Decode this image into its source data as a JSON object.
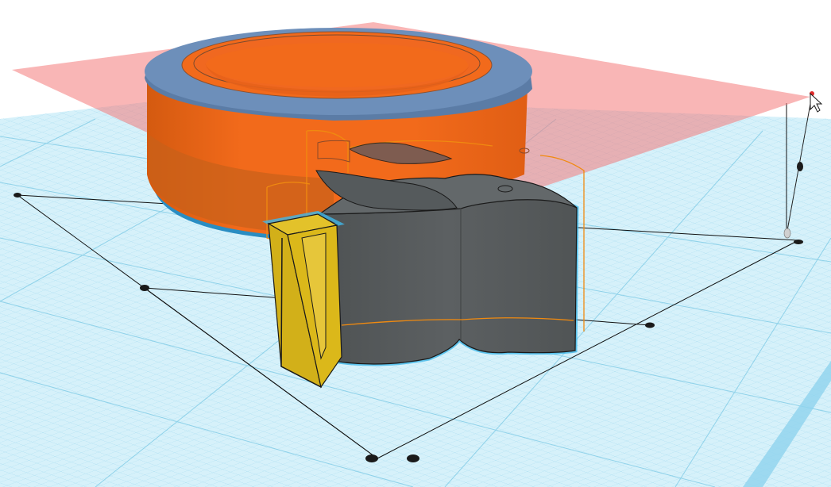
{
  "viewport": {
    "name": "3d-workplane-viewport"
  },
  "colors": {
    "background": "#ffffff",
    "grid_fill": "#d6f1fa",
    "grid_line": "#9fd9ef",
    "grid_line_major": "#7fcbe6",
    "cut_plane": "#f47a7a",
    "ring_orange": "#f26a1b",
    "ring_orange_dark": "#d45a10",
    "ring_band": "#5b7ca6",
    "ring_band_light": "#6d8fba",
    "ring_base": "#2a8dc2",
    "body_gray": "#575b5c",
    "body_gray_light": "#63686a",
    "tab_yellow": "#dbb81a",
    "tab_yellow_dark": "#b89810",
    "selection_outline": "#f08a10",
    "selection_glow": "#40b8e8",
    "handle_black": "#1a1a1a"
  },
  "icons": {
    "cursor": "arrow-pointer-icon",
    "handle": "dimension-handle-icon",
    "height_handle": "height-handle-icon"
  }
}
